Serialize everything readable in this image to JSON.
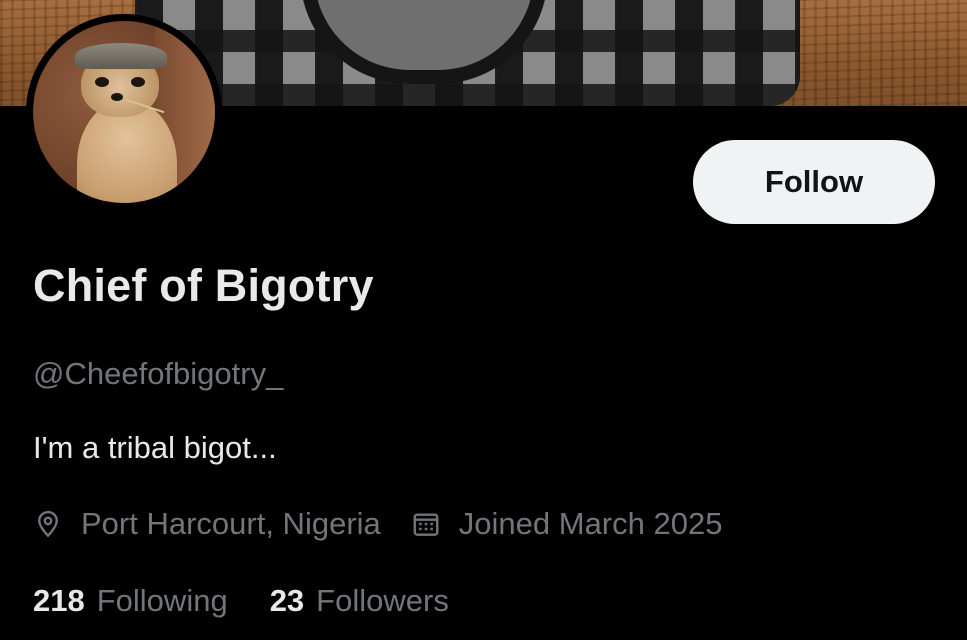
{
  "profile": {
    "display_name": "Chief of Bigotry",
    "handle": "@Cheefofbigotry_",
    "bio": "I'm a tribal bigot...",
    "location": "Port Harcourt, Nigeria",
    "joined": "Joined March 2025",
    "follow_label": "Follow",
    "avatar_subject": "meerkat wearing a flat cap",
    "banner_subject": "plaid knit vest on wooden surface"
  },
  "stats": {
    "following_count": "218",
    "following_label": "Following",
    "followers_count": "23",
    "followers_label": "Followers"
  },
  "icons": {
    "location": "location-pin-icon",
    "calendar": "calendar-icon"
  },
  "colors": {
    "background": "#000000",
    "primary_text": "#e7e9ea",
    "secondary_text": "#71767b",
    "follow_button_bg": "#eff3f4",
    "follow_button_text": "#0f1419"
  }
}
